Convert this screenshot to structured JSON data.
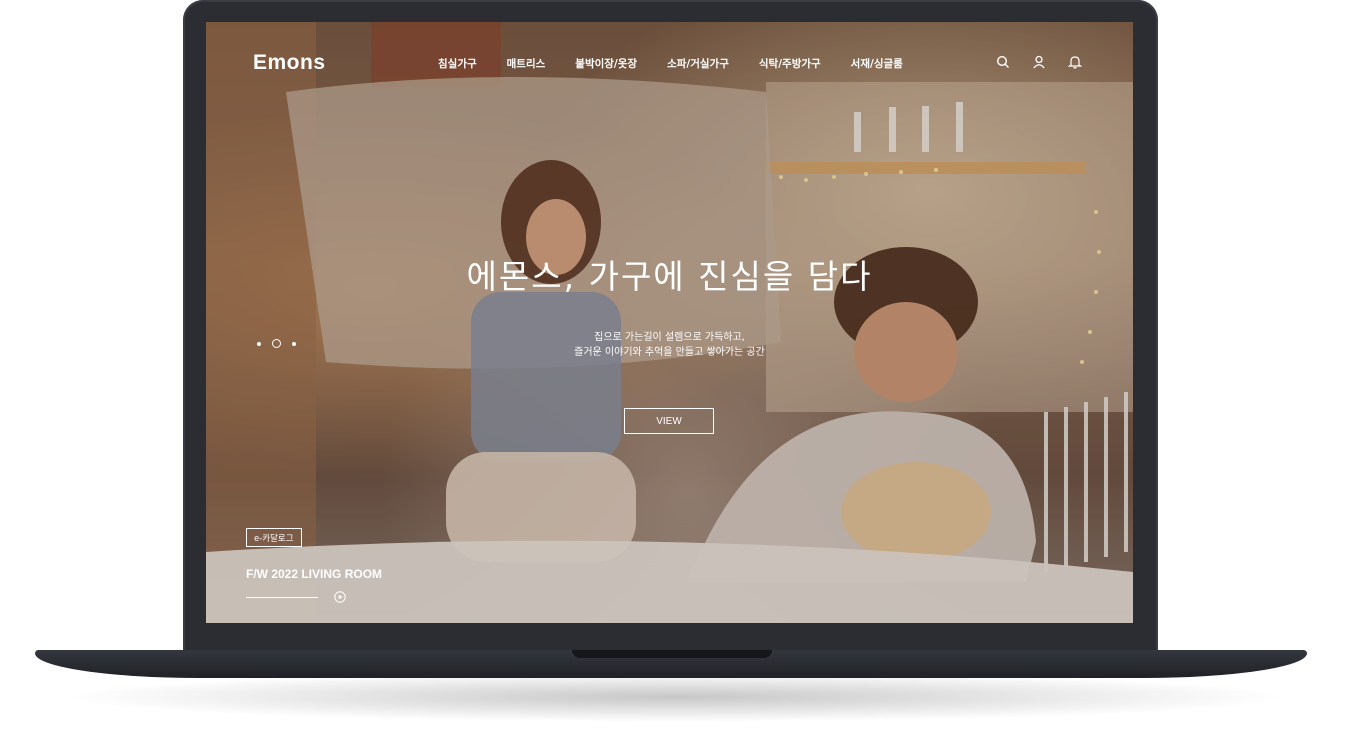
{
  "brand": {
    "logo": "Emons"
  },
  "nav": {
    "items": [
      {
        "label": "침실가구"
      },
      {
        "label": "매트리스"
      },
      {
        "label": "붙박이장/옷장"
      },
      {
        "label": "소파/거실가구"
      },
      {
        "label": "식탁/주방가구"
      },
      {
        "label": "서재/싱글룸"
      }
    ]
  },
  "header_icons": [
    "search-icon",
    "user-icon",
    "bell-icon"
  ],
  "hero": {
    "title": "에몬스, 가구에 진심을 담다",
    "subtitle_line1": "집으로 가는길이 설렘으로 가득하고,",
    "subtitle_line2": "즐거운 이야기와 추억을 만들고 쌓아가는 공간",
    "cta_label": "VIEW"
  },
  "slider": {
    "total": 3,
    "active_index": 1,
    "progress": 1.0
  },
  "catalog_button_label": "e-카달로그",
  "slide_caption": "F/W 2022 LIVING ROOM",
  "colors": {
    "frame": "#2b2d33",
    "text": "#ffffff"
  }
}
